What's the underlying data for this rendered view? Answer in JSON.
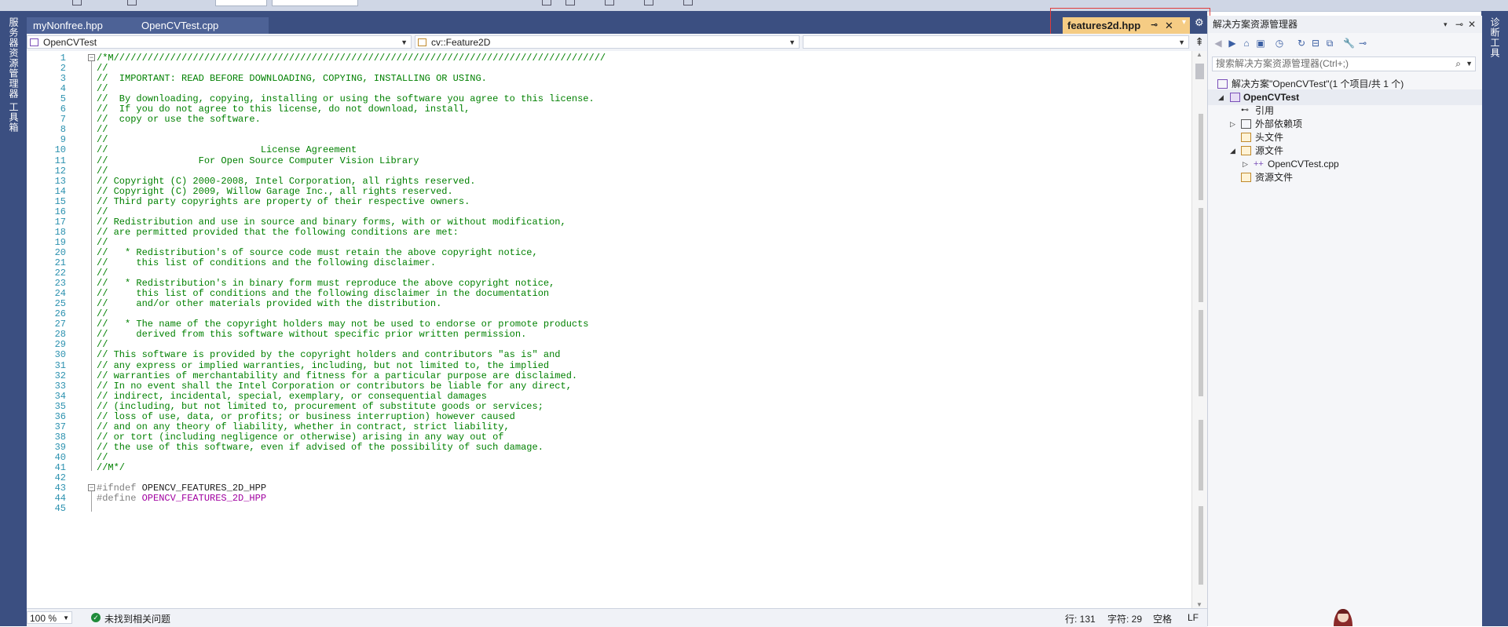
{
  "tabs": {
    "inactive": [
      "myNonfree.hpp",
      "OpenCVTest.cpp"
    ],
    "active": "features2d.hpp"
  },
  "nav": {
    "project": "OpenCVTest",
    "scope": "cv::Feature2D",
    "member": ""
  },
  "side_labels": {
    "left_top": "服务器资源管理器",
    "left_bottom": "工具箱",
    "right": "诊断工具"
  },
  "code_lines": [
    {
      "n": "1",
      "fold": "minus",
      "parts": [
        [
          "cmt",
          "/*M///////////////////////////////////////////////////////////////////////////////////////"
        ]
      ]
    },
    {
      "n": "2",
      "parts": [
        [
          "cmt",
          "//"
        ]
      ]
    },
    {
      "n": "3",
      "parts": [
        [
          "cmt",
          "//  IMPORTANT: READ BEFORE DOWNLOADING, COPYING, INSTALLING OR USING."
        ]
      ]
    },
    {
      "n": "4",
      "parts": [
        [
          "cmt",
          "//"
        ]
      ]
    },
    {
      "n": "5",
      "parts": [
        [
          "cmt",
          "//  By downloading, copying, installing or using the software you agree to this license."
        ]
      ]
    },
    {
      "n": "6",
      "parts": [
        [
          "cmt",
          "//  If you do not agree to this license, do not download, install,"
        ]
      ]
    },
    {
      "n": "7",
      "parts": [
        [
          "cmt",
          "//  copy or use the software."
        ]
      ]
    },
    {
      "n": "8",
      "parts": [
        [
          "cmt",
          "//"
        ]
      ]
    },
    {
      "n": "9",
      "parts": [
        [
          "cmt",
          "//"
        ]
      ]
    },
    {
      "n": "10",
      "parts": [
        [
          "cmt",
          "//                           License Agreement"
        ]
      ]
    },
    {
      "n": "11",
      "parts": [
        [
          "cmt",
          "//                For Open Source Computer Vision Library"
        ]
      ]
    },
    {
      "n": "12",
      "parts": [
        [
          "cmt",
          "//"
        ]
      ]
    },
    {
      "n": "13",
      "parts": [
        [
          "cmt",
          "// Copyright (C) 2000-2008, Intel Corporation, all rights reserved."
        ]
      ]
    },
    {
      "n": "14",
      "parts": [
        [
          "cmt",
          "// Copyright (C) 2009, Willow Garage Inc., all rights reserved."
        ]
      ]
    },
    {
      "n": "15",
      "parts": [
        [
          "cmt",
          "// Third party copyrights are property of their respective owners."
        ]
      ]
    },
    {
      "n": "16",
      "parts": [
        [
          "cmt",
          "//"
        ]
      ]
    },
    {
      "n": "17",
      "parts": [
        [
          "cmt",
          "// Redistribution and use in source and binary forms, with or without modification,"
        ]
      ]
    },
    {
      "n": "18",
      "parts": [
        [
          "cmt",
          "// are permitted provided that the following conditions are met:"
        ]
      ]
    },
    {
      "n": "19",
      "parts": [
        [
          "cmt",
          "//"
        ]
      ]
    },
    {
      "n": "20",
      "parts": [
        [
          "cmt",
          "//   * Redistribution's of source code must retain the above copyright notice,"
        ]
      ]
    },
    {
      "n": "21",
      "parts": [
        [
          "cmt",
          "//     this list of conditions and the following disclaimer."
        ]
      ]
    },
    {
      "n": "22",
      "parts": [
        [
          "cmt",
          "//"
        ]
      ]
    },
    {
      "n": "23",
      "parts": [
        [
          "cmt",
          "//   * Redistribution's in binary form must reproduce the above copyright notice,"
        ]
      ]
    },
    {
      "n": "24",
      "parts": [
        [
          "cmt",
          "//     this list of conditions and the following disclaimer in the documentation"
        ]
      ]
    },
    {
      "n": "25",
      "parts": [
        [
          "cmt",
          "//     and/or other materials provided with the distribution."
        ]
      ]
    },
    {
      "n": "26",
      "parts": [
        [
          "cmt",
          "//"
        ]
      ]
    },
    {
      "n": "27",
      "parts": [
        [
          "cmt",
          "//   * The name of the copyright holders may not be used to endorse or promote products"
        ]
      ]
    },
    {
      "n": "28",
      "parts": [
        [
          "cmt",
          "//     derived from this software without specific prior written permission."
        ]
      ]
    },
    {
      "n": "29",
      "parts": [
        [
          "cmt",
          "//"
        ]
      ]
    },
    {
      "n": "30",
      "parts": [
        [
          "cmt",
          "// This software is provided by the copyright holders and contributors \"as is\" and"
        ]
      ]
    },
    {
      "n": "31",
      "parts": [
        [
          "cmt",
          "// any express or implied warranties, including, but not limited to, the implied"
        ]
      ]
    },
    {
      "n": "32",
      "parts": [
        [
          "cmt",
          "// warranties of merchantability and fitness for a particular purpose are disclaimed."
        ]
      ]
    },
    {
      "n": "33",
      "parts": [
        [
          "cmt",
          "// In no event shall the Intel Corporation or contributors be liable for any direct,"
        ]
      ]
    },
    {
      "n": "34",
      "parts": [
        [
          "cmt",
          "// indirect, incidental, special, exemplary, or consequential damages"
        ]
      ]
    },
    {
      "n": "35",
      "parts": [
        [
          "cmt",
          "// (including, but not limited to, procurement of substitute goods or services;"
        ]
      ]
    },
    {
      "n": "36",
      "parts": [
        [
          "cmt",
          "// loss of use, data, or profits; or business interruption) however caused"
        ]
      ]
    },
    {
      "n": "37",
      "parts": [
        [
          "cmt",
          "// and on any theory of liability, whether in contract, strict liability,"
        ]
      ]
    },
    {
      "n": "38",
      "parts": [
        [
          "cmt",
          "// or tort (including negligence or otherwise) arising in any way out of"
        ]
      ]
    },
    {
      "n": "39",
      "parts": [
        [
          "cmt",
          "// the use of this software, even if advised of the possibility of such damage."
        ]
      ]
    },
    {
      "n": "40",
      "parts": [
        [
          "cmt",
          "//"
        ]
      ]
    },
    {
      "n": "41",
      "parts": [
        [
          "cmt",
          "//M*/"
        ]
      ]
    },
    {
      "n": "42",
      "parts": []
    },
    {
      "n": "43",
      "fold": "minus",
      "parts": [
        [
          "pp",
          "#ifndef "
        ],
        [
          "id",
          "OPENCV_FEATURES_2D_HPP"
        ]
      ]
    },
    {
      "n": "44",
      "parts": [
        [
          "pp",
          "#define "
        ],
        [
          "mac",
          "OPENCV_FEATURES_2D_HPP"
        ]
      ]
    },
    {
      "n": "45",
      "parts": []
    }
  ],
  "status": {
    "zoom": "100 %",
    "issues": "未找到相关问题",
    "line": "行: 131",
    "char": "字符: 29",
    "indent": "空格",
    "eol": "LF"
  },
  "solution_explorer": {
    "title": "解决方案资源管理器",
    "search_placeholder": "搜索解决方案资源管理器(Ctrl+;)",
    "solution": "解决方案\"OpenCVTest\"(1 个项目/共 1 个)",
    "project": "OpenCVTest",
    "references": "引用",
    "external_deps": "外部依赖项",
    "header_files": "头文件",
    "source_files": "源文件",
    "source_file_cpp": "OpenCVTest.cpp",
    "resource_files": "资源文件"
  },
  "colors": {
    "chrome": "#3b4f81",
    "active_tab": "#f5cc84",
    "comment": "#008000",
    "line_number": "#2b91af",
    "macro": "#a000a0",
    "highlight_box": "#e03c3c"
  }
}
